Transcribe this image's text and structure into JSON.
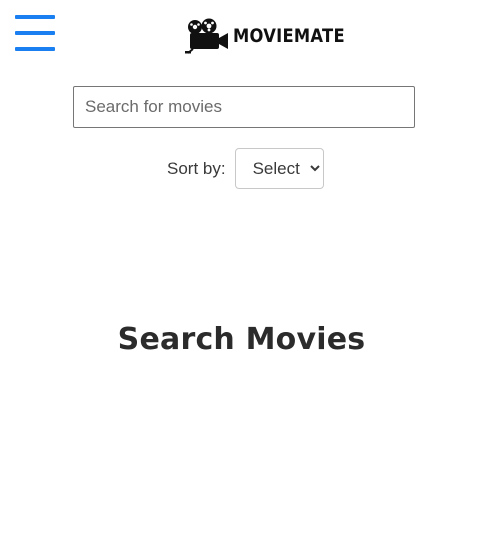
{
  "header": {
    "menu_icon": "hamburger-menu-icon",
    "logo_icon": "film-camera-icon",
    "brand_name": "MOVIEMATE",
    "accent_color": "#1a7ff0"
  },
  "search": {
    "placeholder": "Search for movies",
    "value": ""
  },
  "sort": {
    "label": "Sort by:",
    "selected": "Select"
  },
  "main": {
    "heading": "Search Movies"
  }
}
